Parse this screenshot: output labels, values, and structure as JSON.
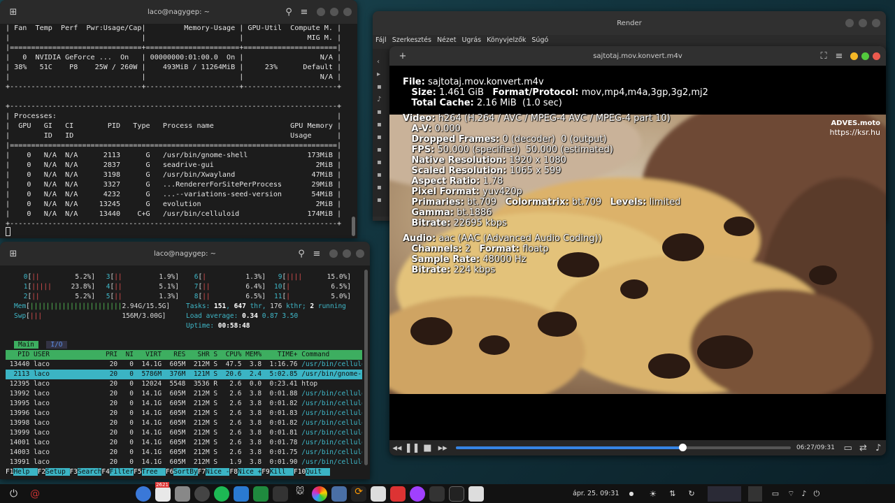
{
  "terminal_nvidia": {
    "title": "laco@nagygep: ~",
    "lines": [
      "| Fan  Temp  Perf  Pwr:Usage/Cap|         Memory-Usage | GPU-Util  Compute M. |",
      "|                               |                      |               MIG M. |",
      "|===============================+======================+======================|",
      "|   0  NVIDIA GeForce ...  On   | 00000000:01:00.0  On |                  N/A |",
      "| 38%   51C    P8    25W / 260W |    493MiB / 11264MiB |     23%      Default |",
      "|                               |                      |                  N/A |",
      "+-------------------------------+----------------------+----------------------+",
      "",
      "+-----------------------------------------------------------------------------+",
      "| Processes:                                                                  |",
      "|  GPU   GI   CI        PID   Type   Process name                  GPU Memory |",
      "|        ID   ID                                                   Usage      |",
      "|=============================================================================|",
      "|    0   N/A  N/A      2113      G   /usr/bin/gnome-shell              173MiB |",
      "|    0   N/A  N/A      2837      G   seadrive-gui                        2MiB |",
      "|    0   N/A  N/A      3198      G   /usr/bin/Xwayland                  47MiB |",
      "|    0   N/A  N/A      3327      G   ...RendererForSitePerProcess       29MiB |",
      "|    0   N/A  N/A      4232      G   ...--variations-seed-version       54MiB |",
      "|    0   N/A  N/A     13245      G   evolution                           2MiB |",
      "|    0   N/A  N/A     13440    C+G   /usr/bin/celluloid                174MiB |",
      "+-----------------------------------------------------------------------------+"
    ]
  },
  "terminal_htop": {
    "title": "laco@nagygep: ~",
    "cpus": [
      {
        "n": "0",
        "bar": "||",
        "pct": "5.2%"
      },
      {
        "n": "3",
        "bar": "||",
        "pct": "1.9%"
      },
      {
        "n": "6",
        "bar": "|",
        "pct": "1.3%"
      },
      {
        "n": "9",
        "bar": "||||",
        "pct": "15.0%"
      },
      {
        "n": "1",
        "bar": "|||||",
        "pct": "23.8%"
      },
      {
        "n": "4",
        "bar": "||",
        "pct": "5.1%"
      },
      {
        "n": "7",
        "bar": "||",
        "pct": "6.4%"
      },
      {
        "n": "10",
        "bar": "|",
        "pct": "6.5%"
      },
      {
        "n": "2",
        "bar": "||",
        "pct": "5.2%"
      },
      {
        "n": "5",
        "bar": "||",
        "pct": "1.3%"
      },
      {
        "n": "8",
        "bar": "||",
        "pct": "6.5%"
      },
      {
        "n": "11",
        "bar": "|",
        "pct": "5.0%"
      }
    ],
    "mem": "2.94G/15.5G",
    "swp": "156M/3.00G",
    "tasks": "151",
    "thr": "647",
    "kthr": "176",
    "running": "2",
    "load": [
      "0.34",
      "0.87",
      "3.50"
    ],
    "uptime": "00:58:48",
    "tabs": [
      "Main",
      "I/O"
    ],
    "header": [
      "PID",
      "USER",
      "PRI",
      "NI",
      "VIRT",
      "RES",
      "SHR",
      "S",
      "CPU%",
      "MEM%",
      "TIME+",
      "Command"
    ],
    "rows": [
      [
        "13440",
        "laco",
        "20",
        "0",
        "14.1G",
        "605M",
        "212M",
        "S",
        "47.5",
        "3.8",
        "1:16.76",
        "/usr/bin/celluloid"
      ],
      [
        "2113",
        "laco",
        "20",
        "0",
        "5786M",
        "376M",
        "121M",
        "S",
        "20.6",
        "2.4",
        "5:02.85",
        "/usr/bin/gnome-she"
      ],
      [
        "12395",
        "laco",
        "20",
        "0",
        "12024",
        "5548",
        "3536",
        "R",
        "2.6",
        "0.0",
        "0:23.41",
        "htop"
      ],
      [
        "13992",
        "laco",
        "20",
        "0",
        "14.1G",
        "605M",
        "212M",
        "S",
        "2.6",
        "3.8",
        "0:01.88",
        "/usr/bin/celluloid"
      ],
      [
        "13995",
        "laco",
        "20",
        "0",
        "14.1G",
        "605M",
        "212M",
        "S",
        "2.6",
        "3.8",
        "0:01.82",
        "/usr/bin/celluloid"
      ],
      [
        "13996",
        "laco",
        "20",
        "0",
        "14.1G",
        "605M",
        "212M",
        "S",
        "2.6",
        "3.8",
        "0:01.83",
        "/usr/bin/celluloid"
      ],
      [
        "13998",
        "laco",
        "20",
        "0",
        "14.1G",
        "605M",
        "212M",
        "S",
        "2.6",
        "3.8",
        "0:01.82",
        "/usr/bin/celluloid"
      ],
      [
        "13999",
        "laco",
        "20",
        "0",
        "14.1G",
        "605M",
        "212M",
        "S",
        "2.6",
        "3.8",
        "0:01.81",
        "/usr/bin/celluloid"
      ],
      [
        "14001",
        "laco",
        "20",
        "0",
        "14.1G",
        "605M",
        "212M",
        "S",
        "2.6",
        "3.8",
        "0:01.78",
        "/usr/bin/celluloid"
      ],
      [
        "14003",
        "laco",
        "20",
        "0",
        "14.1G",
        "605M",
        "212M",
        "S",
        "2.6",
        "3.8",
        "0:01.75",
        "/usr/bin/celluloid"
      ],
      [
        "13991",
        "laco",
        "20",
        "0",
        "14.1G",
        "605M",
        "212M",
        "S",
        "1.9",
        "3.8",
        "0:01.90",
        "/usr/bin/celluloid"
      ]
    ],
    "fkeys": [
      [
        "F1",
        "Help"
      ],
      [
        "F2",
        "Setup"
      ],
      [
        "F3",
        "Search"
      ],
      [
        "F4",
        "Filter"
      ],
      [
        "F5",
        "Tree"
      ],
      [
        "F6",
        "SortBy"
      ],
      [
        "F7",
        "Nice -"
      ],
      [
        "F8",
        "Nice +"
      ],
      [
        "F9",
        "Kill"
      ],
      [
        "F10",
        "Quit"
      ]
    ]
  },
  "render": {
    "title": "Render",
    "menu": [
      "Fájl",
      "Szerkesztés",
      "Nézet",
      "Ugrás",
      "Könyvjelzők",
      "Súgó"
    ]
  },
  "celluloid": {
    "title": "sajtotaj.mov.konvert.m4v",
    "watermark": "ADVES.moto",
    "watermark_url": "https://ksr.hu",
    "stats": {
      "file_label": "File:",
      "file": "sajtotaj.mov.konvert.m4v",
      "size_label": "Size:",
      "size": "1.461 GiB",
      "format_label": "Format/Protocol:",
      "format": "mov,mp4,m4a,3gp,3g2,mj2",
      "cache_label": "Total Cache:",
      "cache": "2.16 MiB  (1.0 sec)",
      "video_label": "Video:",
      "video": "h264 (H.264 / AVC / MPEG-4 AVC / MPEG-4 part 10)",
      "av_label": "A-V:",
      "av": "0.000",
      "dropped_label": "Dropped Frames:",
      "dropped": "0 (decoder)  0 (output)",
      "fps_label": "FPS:",
      "fps": "50.000 (specified)  50.000 (estimated)",
      "native_label": "Native Resolution:",
      "native": "1920 x 1080",
      "scaled_label": "Scaled Resolution:",
      "scaled": "1065 x 599",
      "aspect_label": "Aspect Ratio:",
      "aspect": "1.78",
      "pixfmt_label": "Pixel Format:",
      "pixfmt": "yuv420p",
      "prim_label": "Primaries:",
      "prim": "bt.709",
      "cm_label": "Colormatrix:",
      "cm": "bt.709",
      "levels_label": "Levels:",
      "levels": "limited",
      "gamma_label": "Gamma:",
      "gamma": "bt.1886",
      "vbit_label": "Bitrate:",
      "vbit": "22695 kbps",
      "audio_label": "Audio:",
      "audio": "aac (AAC (Advanced Audio Coding))",
      "chan_label": "Channels:",
      "chan": "2",
      "afmt_label": "Format:",
      "afmt": "floatp",
      "rate_label": "Sample Rate:",
      "rate": "48000 Hz",
      "abit_label": "Bitrate:",
      "abit": "224 kbps"
    },
    "time": "06:27/09:31",
    "progress": 0.677
  },
  "taskbar": {
    "clock": "ápr. 25.  09:31",
    "calendar_badge": "2621",
    "accent": "#3dae60"
  }
}
